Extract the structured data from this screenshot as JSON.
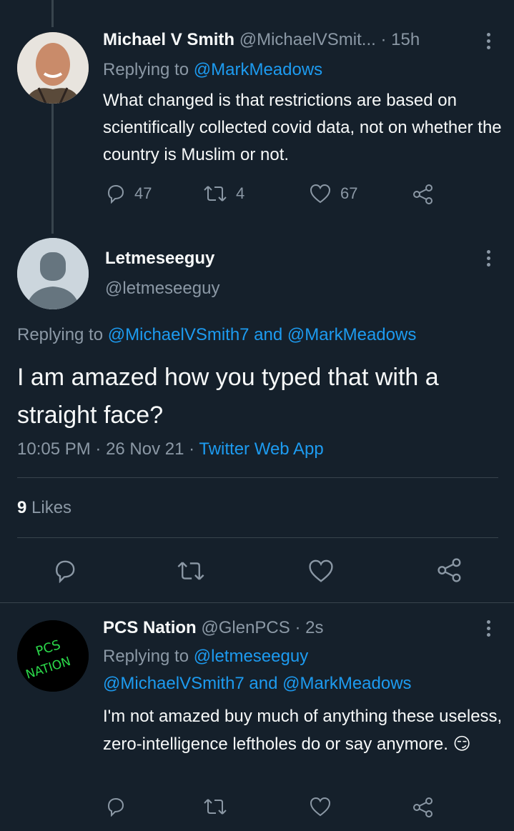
{
  "reply1": {
    "name": "Michael V Smith",
    "handle": "@MichaelVSmit...",
    "time": "· 15h",
    "replying_prefix": "Replying to ",
    "replying_to": "@MarkMeadows",
    "text": "What changed is that restrictions are based on scientifically collected covid data, not on whether the country is Muslim or not.",
    "replies": "47",
    "retweets": "4",
    "likes": "67"
  },
  "main": {
    "name": "Letmeseeguy",
    "handle": "@letmeseeguy",
    "replying_prefix": "Replying to ",
    "replying_to_1": "@MichaelVSmith7",
    "replying_and": " and ",
    "replying_to_2": "@MarkMeadows",
    "text": "I am amazed how you typed that with a straight face?",
    "time": "10:05 PM",
    "date": "· 26 Nov 21 ·",
    "source": "Twitter Web App",
    "likes_count": "9",
    "likes_label": "Likes"
  },
  "reply2": {
    "name": "PCS Nation",
    "handle": "@GlenPCS",
    "time": "· 2s",
    "replying_prefix": "Replying to ",
    "replying_to_1": "@letmeseeguy",
    "replying_line2": "@MichaelVSmith7 and @MarkMeadows",
    "text": "I'm not amazed buy much of anything these useless, zero-intelligence leftholes do or say anymore. 😏",
    "avatar_text_1": "PCS",
    "avatar_text_2": "NATION"
  },
  "colors": {
    "background": "#15202b",
    "accent": "#1d9bf0",
    "muted": "#8b98a5",
    "divider": "#38444d"
  }
}
